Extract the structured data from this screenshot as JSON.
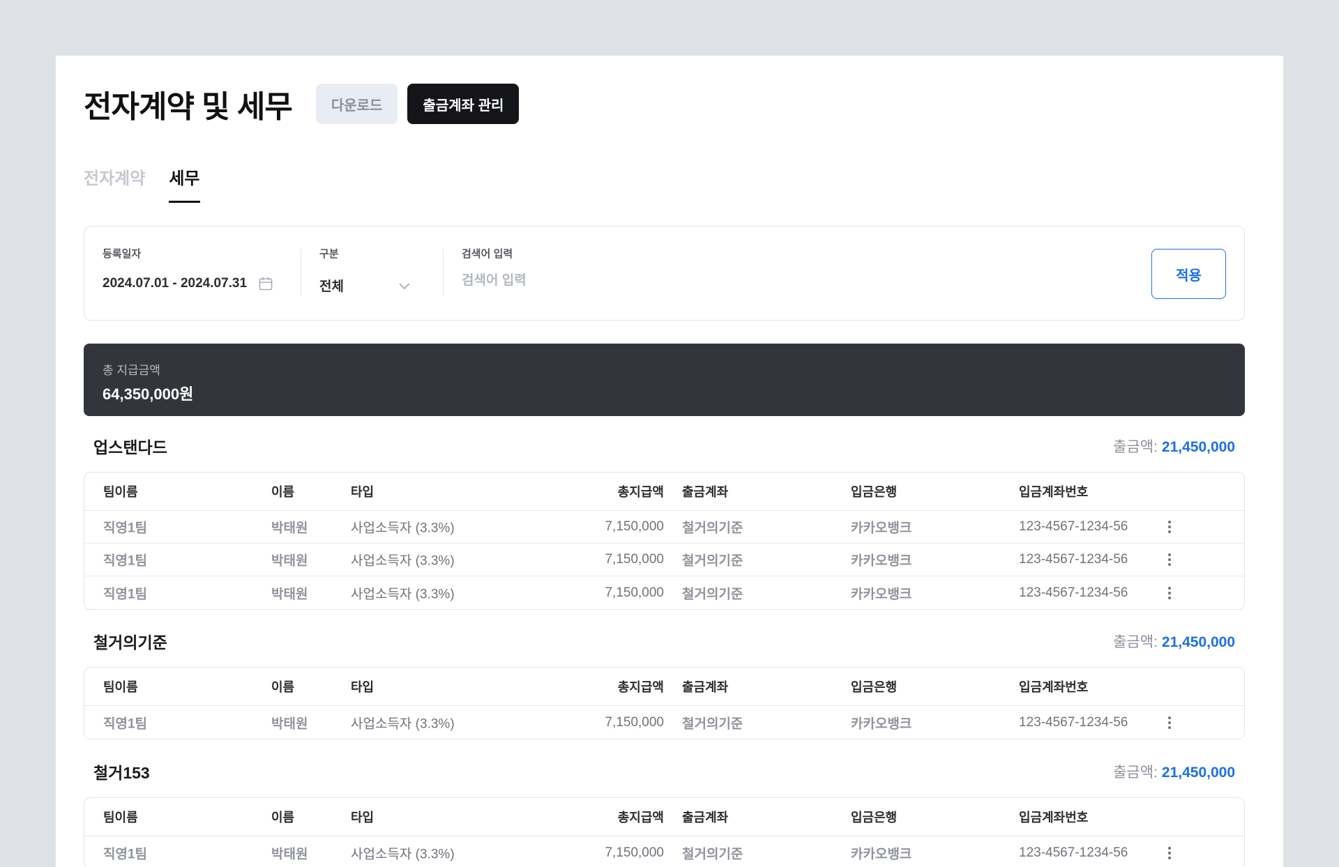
{
  "header": {
    "title": "전자계약 및 세무",
    "download_label": "다운로드",
    "account_manage_label": "출금계좌 관리"
  },
  "tabs": [
    {
      "label": "전자계약",
      "active": false
    },
    {
      "label": "세무",
      "active": true
    }
  ],
  "filter": {
    "date_label": "등록일자",
    "date_value": "2024.07.01 - 2024.07.31",
    "category_label": "구분",
    "category_value": "전체",
    "search_label": "검색어 입력",
    "search_placeholder": "검색어 입력",
    "apply_label": "적용"
  },
  "total": {
    "label": "총 지급금액",
    "value": "64,350,000원"
  },
  "columns": {
    "team": "팀이름",
    "name": "이름",
    "type": "타입",
    "total": "총지급액",
    "out_account": "출금계좌",
    "bank": "입금은행",
    "account_no": "입금계좌번호"
  },
  "groups": [
    {
      "name": "업스탠다드",
      "amount_label": "출금액:",
      "amount": "21,450,000",
      "rows": [
        {
          "team": "직영1팀",
          "name": "박태원",
          "type": "사업소득자 (3.3%)",
          "total": "7,150,000",
          "out_account": "철거의기준",
          "bank": "카카오뱅크",
          "account_no": "123-4567-1234-56"
        },
        {
          "team": "직영1팀",
          "name": "박태원",
          "type": "사업소득자 (3.3%)",
          "total": "7,150,000",
          "out_account": "철거의기준",
          "bank": "카카오뱅크",
          "account_no": "123-4567-1234-56"
        },
        {
          "team": "직영1팀",
          "name": "박태원",
          "type": "사업소득자 (3.3%)",
          "total": "7,150,000",
          "out_account": "철거의기준",
          "bank": "카카오뱅크",
          "account_no": "123-4567-1234-56"
        }
      ]
    },
    {
      "name": "철거의기준",
      "amount_label": "출금액:",
      "amount": "21,450,000",
      "rows": [
        {
          "team": "직영1팀",
          "name": "박태원",
          "type": "사업소득자 (3.3%)",
          "total": "7,150,000",
          "out_account": "철거의기준",
          "bank": "카카오뱅크",
          "account_no": "123-4567-1234-56"
        }
      ]
    },
    {
      "name": "철거153",
      "amount_label": "출금액:",
      "amount": "21,450,000",
      "rows": [
        {
          "team": "직영1팀",
          "name": "박태원",
          "type": "사업소득자 (3.3%)",
          "total": "7,150,000",
          "out_account": "철거의기준",
          "bank": "카카오뱅크",
          "account_no": "123-4567-1234-56"
        }
      ]
    }
  ],
  "icons": {
    "calendar": "calendar-icon",
    "chevron": "chevron-down-icon",
    "more": "more-vertical-icon"
  },
  "colors": {
    "accent": "#1f6fe5",
    "dark": "#141518",
    "total_bar": "#32353b"
  }
}
